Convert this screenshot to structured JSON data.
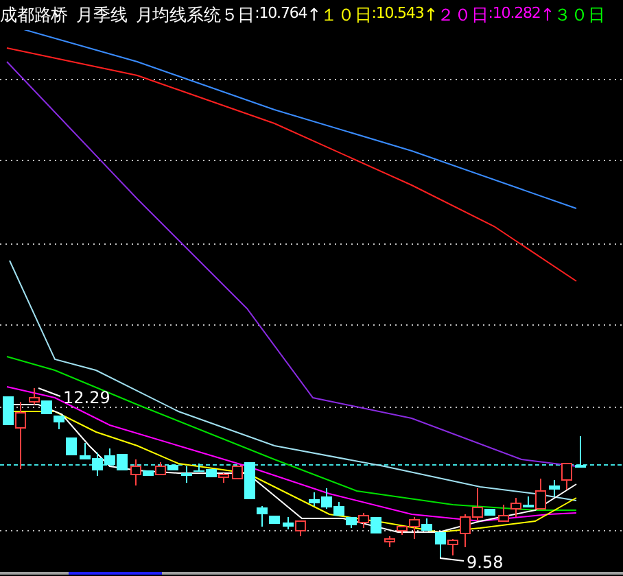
{
  "header": {
    "title": "成都路桥",
    "period": "月季线",
    "indicator": "月均线系统",
    "averages": [
      {
        "label": "５日",
        "value": ":10.764",
        "arrow": "↑",
        "color": "#ffffff"
      },
      {
        "label": "１０日",
        "value": ":10.543",
        "arrow": "↑",
        "color": "#ffff00"
      },
      {
        "label": "２０日",
        "value": ":10.282",
        "arrow": "↑",
        "color": "#ff00ff"
      },
      {
        "label": "３０日",
        "color": "#00ff00"
      }
    ]
  },
  "chart": {
    "high_label": "12.29",
    "low_label": "9.58"
  }
}
